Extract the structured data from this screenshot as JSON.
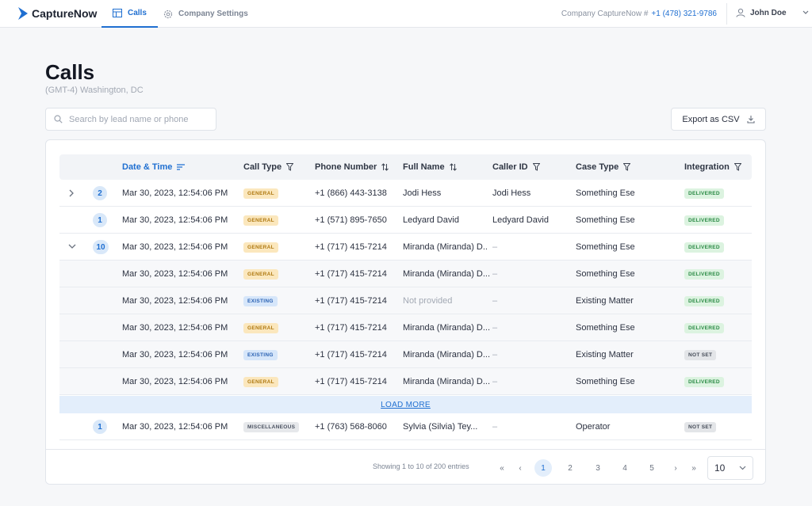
{
  "app": {
    "name": "CaptureNow",
    "brand_color": "#1f6fd1"
  },
  "nav": {
    "tabs": [
      {
        "label": "Calls",
        "active": true
      },
      {
        "label": "Company Settings",
        "active": false
      }
    ]
  },
  "header": {
    "company_label": "Company CaptureNow #",
    "company_phone": "+1 (478) 321-9786",
    "user_name": "John Doe"
  },
  "page": {
    "title": "Calls",
    "timezone": "(GMT-4) Washington, DC"
  },
  "search": {
    "placeholder": "Search by lead name or phone",
    "value": ""
  },
  "export_label": "Export as CSV",
  "table": {
    "columns": [
      "Date & Time",
      "Call Type",
      "Phone Number",
      "Full Name",
      "Caller ID",
      "Case Type",
      "Integration"
    ],
    "rows": [
      {
        "kind": "group",
        "toggle": "collapsed",
        "count": "2",
        "datetime": "Mar 30, 2023, 12:54:06 PM",
        "call_type": "GENERAL",
        "phone": "+1 (866) 443-3138",
        "name": "Jodi Hess",
        "caller_id": "Jodi Hess",
        "case_type": "Something Ese",
        "integration": "DELIVERED"
      },
      {
        "kind": "group",
        "toggle": "none",
        "count": "1",
        "datetime": "Mar 30, 2023, 12:54:06 PM",
        "call_type": "GENERAL",
        "phone": "+1 (571) 895-7650",
        "name": "Ledyard David",
        "caller_id": "Ledyard David",
        "case_type": "Something Ese",
        "integration": "DELIVERED"
      },
      {
        "kind": "group",
        "toggle": "expanded",
        "count": "10",
        "datetime": "Mar 30, 2023, 12:54:06 PM",
        "call_type": "GENERAL",
        "phone": "+1 (717) 415-7214",
        "name": "Miranda (Miranda) D..",
        "caller_id": "–",
        "case_type": "Something Ese",
        "integration": "DELIVERED"
      },
      {
        "kind": "child",
        "datetime": "Mar 30, 2023, 12:54:06 PM",
        "call_type": "GENERAL",
        "phone": "+1 (717) 415-7214",
        "name": "Miranda (Miranda) D...",
        "caller_id": "–",
        "case_type": "Something Ese",
        "integration": "DELIVERED"
      },
      {
        "kind": "child",
        "datetime": "Mar 30, 2023, 12:54:06 PM",
        "call_type": "EXISTING",
        "phone": "+1 (717) 415-7214",
        "name": "Not provided",
        "caller_id": "–",
        "case_type": "Existing Matter",
        "integration": "DELIVERED"
      },
      {
        "kind": "child",
        "datetime": "Mar 30, 2023, 12:54:06 PM",
        "call_type": "GENERAL",
        "phone": "+1 (717) 415-7214",
        "name": "Miranda (Miranda) D...",
        "caller_id": "–",
        "case_type": "Something Ese",
        "integration": "DELIVERED"
      },
      {
        "kind": "child",
        "datetime": "Mar 30, 2023, 12:54:06 PM",
        "call_type": "EXISTING",
        "phone": "+1 (717) 415-7214",
        "name": "Miranda (Miranda) D...",
        "caller_id": "–",
        "case_type": "Existing Matter",
        "integration": "NOT SET"
      },
      {
        "kind": "child",
        "datetime": "Mar 30, 2023, 12:54:06 PM",
        "call_type": "GENERAL",
        "phone": "+1 (717) 415-7214",
        "name": "Miranda (Miranda) D...",
        "caller_id": "–",
        "case_type": "Something Ese",
        "integration": "DELIVERED"
      }
    ],
    "load_more_label": "LOAD MORE",
    "after_rows": [
      {
        "kind": "group",
        "toggle": "none",
        "count": "1",
        "datetime": "Mar 30, 2023, 12:54:06 PM",
        "call_type": "MISCELLANEOUS",
        "phone": "+1 (763) 568-8060",
        "name": "Sylvia (Silvia) Tey...",
        "caller_id": "–",
        "case_type": "Operator",
        "integration": "NOT SET"
      }
    ]
  },
  "pagination": {
    "summary": "Showing 1 to 10 of 200 entries",
    "pages": [
      "1",
      "2",
      "3",
      "4",
      "5"
    ],
    "current": "1",
    "page_size": "10"
  }
}
